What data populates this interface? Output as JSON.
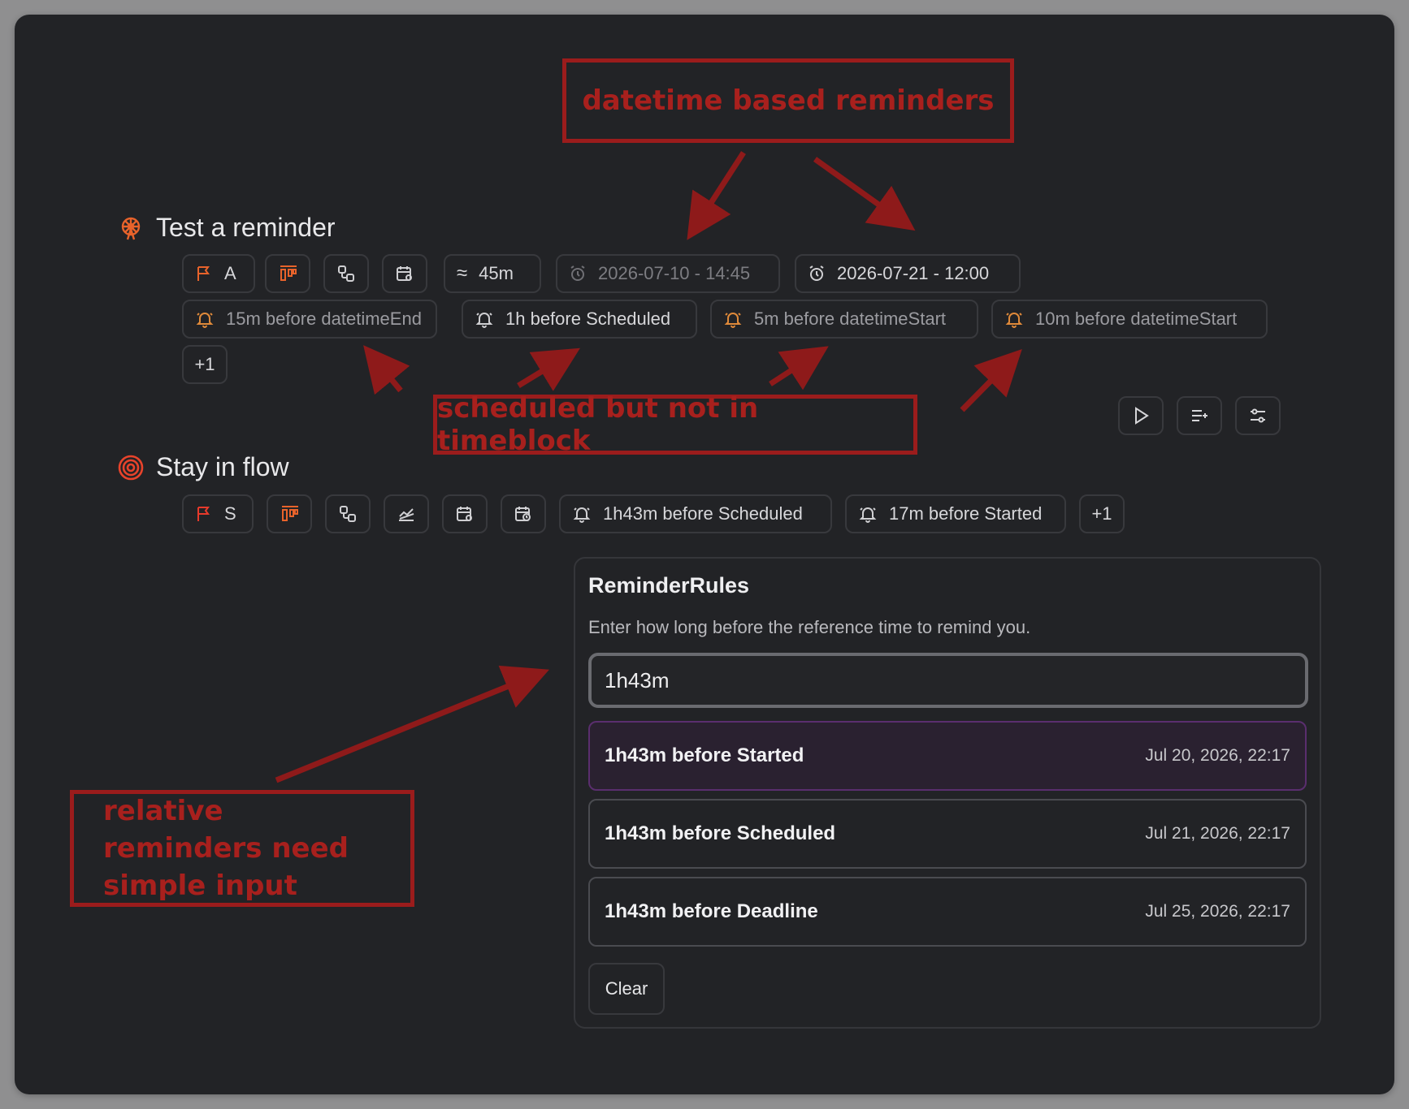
{
  "colors": {
    "accent": "#e8632b",
    "annotation": "#9b1c1c",
    "background": "#222326"
  },
  "tasks": [
    {
      "title": "Test a reminder",
      "icon": "ferris-wheel-icon",
      "chips": {
        "priority": "A",
        "duration": "45m",
        "datetime_start": "2026-07-10 - 14:45",
        "datetime_end": "2026-07-21 - 12:00"
      },
      "reminders": [
        "15m before datetimeEnd",
        "1h before Scheduled",
        "5m before datetimeStart",
        "10m before datetimeStart"
      ],
      "more": "+1"
    },
    {
      "title": "Stay in flow",
      "icon": "target-icon",
      "chips": {
        "priority": "S"
      },
      "reminders": [
        "1h43m before Scheduled",
        "17m before Started"
      ],
      "more": "+1"
    }
  ],
  "annotations": {
    "top": "datetime based reminders",
    "middle": "scheduled but not in timeblock",
    "bottom": "relative reminders need simple input"
  },
  "popover": {
    "title": "ReminderRules",
    "description": "Enter how long before the reference time to remind you.",
    "input_value": "1h43m",
    "options": [
      {
        "label": "1h43m before Started",
        "date": "Jul 20, 2026, 22:17",
        "selected": true
      },
      {
        "label": "1h43m before Scheduled",
        "date": "Jul 21, 2026, 22:17",
        "selected": false
      },
      {
        "label": "1h43m before Deadline",
        "date": "Jul 25, 2026, 22:17",
        "selected": false
      }
    ],
    "clear_label": "Clear"
  }
}
